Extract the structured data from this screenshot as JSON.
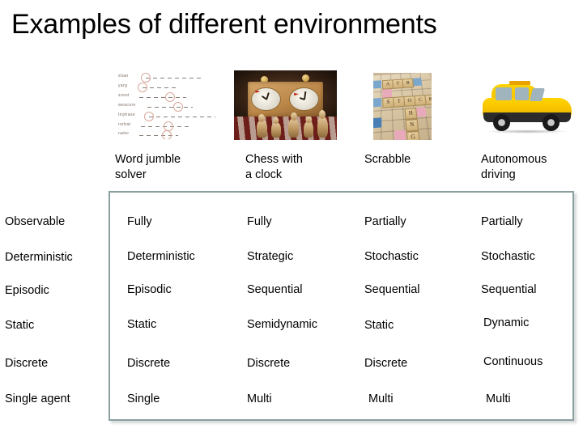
{
  "slide": {
    "title": "Examples of different environments"
  },
  "images": [
    {
      "name": "word-jumble-image",
      "alt": "Word jumble puzzle worksheet",
      "jumble_rows": 7
    },
    {
      "name": "chess-clock-image",
      "alt": "Chess pieces with a chess clock"
    },
    {
      "name": "scrabble-image",
      "alt": "Scrabble board with tiles"
    },
    {
      "name": "taxi-image",
      "alt": "Yellow taxi cab"
    }
  ],
  "table": {
    "columns": [
      {
        "label": "Word jumble\nsolver",
        "line1": "Word jumble",
        "line2": "solver"
      },
      {
        "label": "Chess with\na clock",
        "line1": "Chess with",
        "line2": "a clock"
      },
      {
        "label": "Scrabble",
        "line1": "Scrabble",
        "line2": ""
      },
      {
        "label": "Autonomous\ndriving",
        "line1": "Autonomous",
        "line2": "driving"
      }
    ],
    "row_labels": [
      "Observable",
      "Deterministic",
      "Episodic",
      "Static",
      "Discrete",
      "Single agent"
    ],
    "rows": [
      {
        "label": "Observable",
        "cells": [
          "Fully",
          "Fully",
          "Partially",
          "Partially"
        ]
      },
      {
        "label": "Deterministic",
        "cells": [
          "Deterministic",
          "Strategic",
          "Stochastic",
          "Stochastic"
        ]
      },
      {
        "label": "Episodic",
        "cells": [
          "Episodic",
          "Sequential",
          "Sequential",
          "Sequential"
        ]
      },
      {
        "label": "Static",
        "cells": [
          "Static",
          "Semidynamic",
          "Static",
          "Dynamic"
        ]
      },
      {
        "label": "Discrete",
        "cells": [
          "Discrete",
          "Discrete",
          "Discrete",
          "Continuous"
        ]
      },
      {
        "label": "Single agent",
        "cells": [
          "Single",
          "Multi",
          "Multi",
          "Multi"
        ]
      }
    ]
  },
  "colors": {
    "border": "#8a9fa0",
    "text": "#000000",
    "background": "#ffffff",
    "taxi_yellow": "#ffd400"
  }
}
